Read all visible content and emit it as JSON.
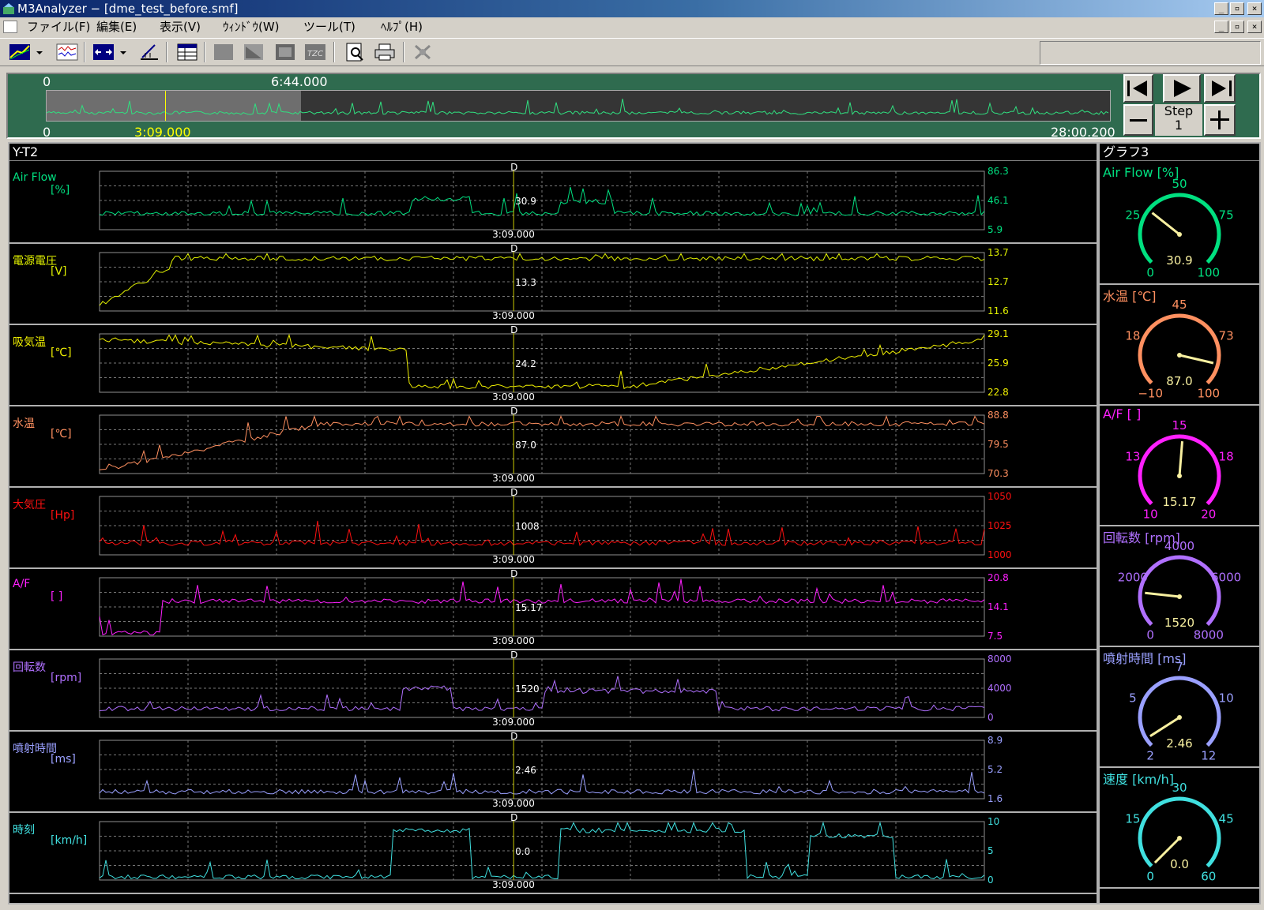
{
  "window": {
    "title": "M3Analyzer − [dme_test_before.smf]"
  },
  "menu": [
    "ファイル(F)",
    "編集(E)",
    "表示(V)",
    "ｳｨﾝﾄﾞｳ(W)",
    "ツール(T)",
    "ﾍﾙﾌﾟ(H)"
  ],
  "toolbar": {
    "icons": [
      "yt-graph-icon",
      "dropdown-arrow-icon",
      "waveform-icon",
      "compare-icon",
      "dropdown-arrow-icon",
      "measure-icon",
      "table-icon",
      "gray-square-icon",
      "gray-slope-icon",
      "gray-frame-icon",
      "tzc-icon",
      "print-preview-icon",
      "print-icon",
      "disabled-tool-icon"
    ]
  },
  "overview": {
    "window_label": "6:44.000",
    "start_label": "0",
    "start_label_bottom": "0",
    "cursor_label": "3:09.000",
    "end_label": "28:00.200",
    "step_label": "Step",
    "step_value": "1"
  },
  "yt": {
    "title": "Y-T2",
    "cursor_time": "3:09.000",
    "cursor_marker": "D",
    "cursor_fraction": 0.468
  },
  "charts": [
    {
      "label": "Air Flow",
      "unit": "[%]",
      "color": "#00e080",
      "ticks": [
        "86.3",
        "46.1",
        "5.9"
      ],
      "value": "30.9"
    },
    {
      "label": "電源電圧",
      "unit": "[V]",
      "color": "#e0f000",
      "ticks": [
        "13.7",
        "12.7",
        "11.6"
      ],
      "value": "13.3"
    },
    {
      "label": "吸気温",
      "unit": "[℃]",
      "color": "#f0f000",
      "ticks": [
        "29.1",
        "25.9",
        "22.8"
      ],
      "value": "24.2"
    },
    {
      "label": "水温",
      "unit": "[℃]",
      "color": "#ff9060",
      "ticks": [
        "88.8",
        "79.5",
        "70.3"
      ],
      "value": "87.0"
    },
    {
      "label": "大気圧",
      "unit": "[Hp]",
      "color": "#ff1010",
      "ticks": [
        "1050",
        "1025",
        "1000"
      ],
      "value": "1008"
    },
    {
      "label": "A/F",
      "unit": "[ ]",
      "color": "#ff20ff",
      "ticks": [
        "20.8",
        "14.1",
        "7.5"
      ],
      "value": "15.17"
    },
    {
      "label": "回転数",
      "unit": "[rpm]",
      "color": "#b070ff",
      "ticks": [
        "8000",
        "4000",
        "0"
      ],
      "value": "1520"
    },
    {
      "label": "噴射時間",
      "unit": "[ms]",
      "color": "#9aa0ff",
      "ticks": [
        "8.9",
        "5.2",
        "1.6"
      ],
      "value": "2.46"
    },
    {
      "label": "時刻",
      "unit": "[km/h]",
      "color": "#40e0e0",
      "ticks": [
        "10",
        "5",
        "0"
      ],
      "value": "0.0"
    }
  ],
  "graph3": {
    "title": "グラフ3",
    "gauges": [
      {
        "title": "Air Flow [%]",
        "color": "#00e080",
        "labels": [
          "0",
          "25",
          "50",
          "75",
          "100"
        ],
        "min": 0,
        "max": 100,
        "value": 30.9,
        "value_text": "30.9"
      },
      {
        "title": "水温 [℃]",
        "color": "#ff9060",
        "labels": [
          "−10",
          "18",
          "45",
          "73",
          "100"
        ],
        "min": -10,
        "max": 100,
        "value": 87.0,
        "value_text": "87.0"
      },
      {
        "title": "A/F [ ]",
        "color": "#ff20ff",
        "labels": [
          "10",
          "13",
          "15",
          "18",
          "20"
        ],
        "min": 10,
        "max": 20,
        "value": 15.17,
        "value_text": "15.17"
      },
      {
        "title": "回転数 [rpm]",
        "color": "#b070ff",
        "labels": [
          "0",
          "2000",
          "4000",
          "6000",
          "8000"
        ],
        "min": 0,
        "max": 8000,
        "value": 1520,
        "value_text": "1520"
      },
      {
        "title": "噴射時間 [ms]",
        "color": "#9aa0ff",
        "labels": [
          "2",
          "5",
          "7",
          "10",
          "12"
        ],
        "min": 2,
        "max": 12,
        "value": 2.46,
        "value_text": "2.46"
      },
      {
        "title": "速度 [km/h]",
        "color": "#40e0e0",
        "labels": [
          "0",
          "15",
          "30",
          "45",
          "60"
        ],
        "min": 0,
        "max": 60,
        "value": 0.0,
        "value_text": "0.0"
      }
    ]
  }
}
